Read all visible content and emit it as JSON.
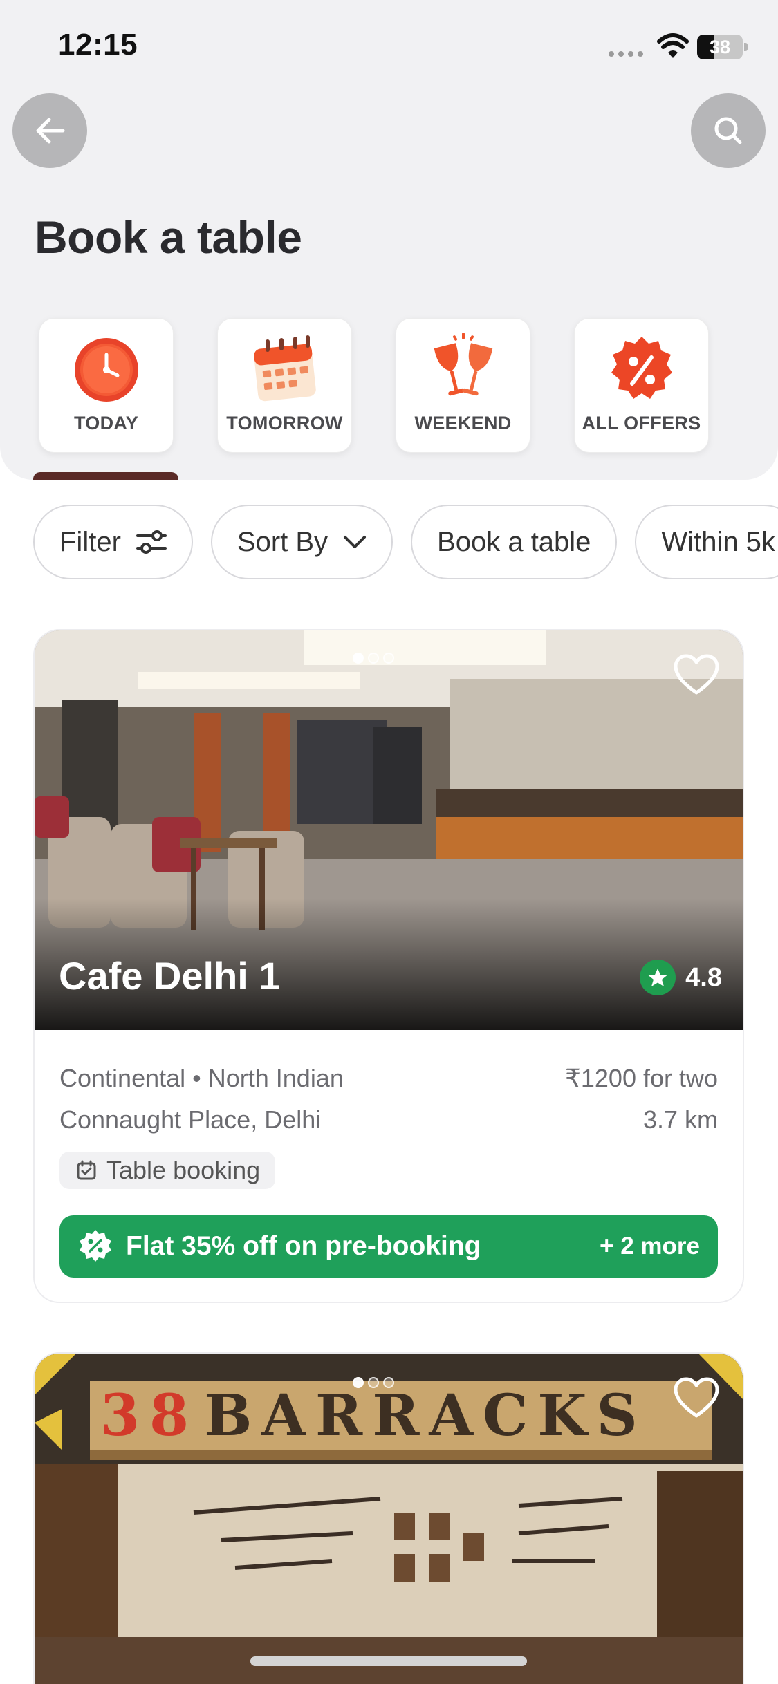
{
  "status_bar": {
    "time": "12:15",
    "battery": "38",
    "battery_level": 0.38
  },
  "header": {
    "title": "Book a table"
  },
  "quick_tiles": [
    {
      "label": "TODAY",
      "icon": "clock-icon"
    },
    {
      "label": "TOMORROW",
      "icon": "calendar-icon"
    },
    {
      "label": "WEEKEND",
      "icon": "cheers-glasses-icon"
    },
    {
      "label": "ALL OFFERS",
      "icon": "offer-badge-icon"
    }
  ],
  "filters": [
    {
      "label": "Filter",
      "icon": "sliders-icon"
    },
    {
      "label": "Sort By",
      "icon": "chevron-down-icon"
    },
    {
      "label": "Book a table"
    },
    {
      "label": "Within 5k"
    }
  ],
  "restaurants": [
    {
      "name": "Cafe Delhi 1",
      "rating": "4.8",
      "cuisines": "Continental • North Indian",
      "price": "₹1200 for two",
      "location": "Connaught Place, Delhi",
      "distance": "3.7 km",
      "tag": "Table booking",
      "offer": "Flat 35% off on pre-booking",
      "offer_more": "+ 2 more"
    },
    {
      "sign_text": "38 BARRACKS"
    }
  ],
  "colors": {
    "accent_green": "#1fa05a",
    "icon_orange": "#f0542a",
    "header_bg": "#f1f1f3"
  }
}
